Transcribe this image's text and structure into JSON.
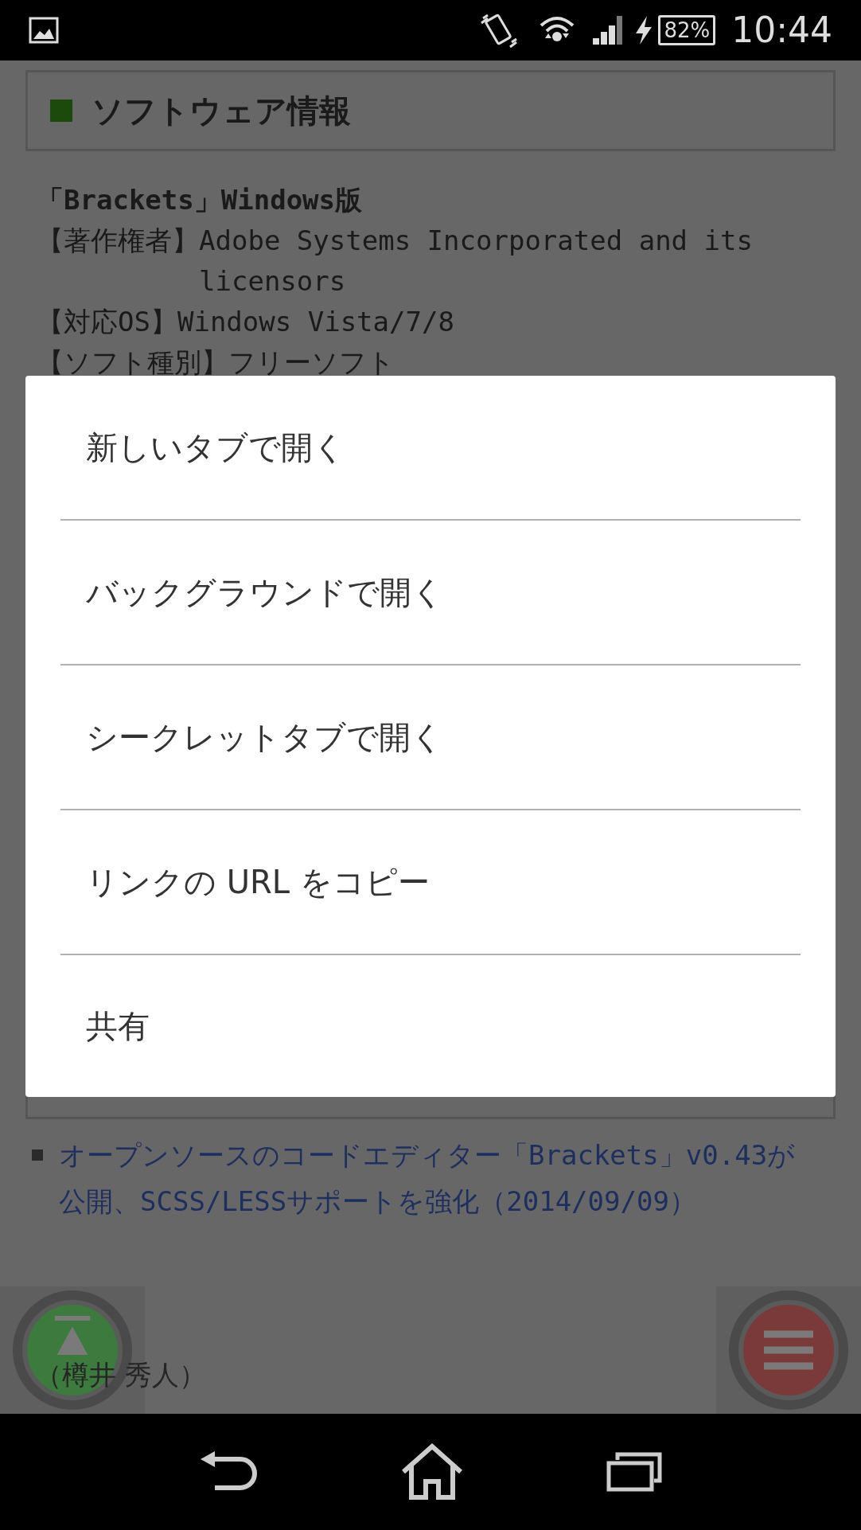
{
  "status_bar": {
    "battery": "82%",
    "time": "10:44"
  },
  "page": {
    "section_title": "ソフトウェア情報",
    "software_name": "「Brackets」Windows版",
    "info_lines": [
      {
        "label": "【著作権者】",
        "value": "Adobe Systems Incorporated and its licensors"
      },
      {
        "label": "【対応OS】",
        "value": "Windows Vista/7/8"
      },
      {
        "label": "【ソフト種別】",
        "value": "フリーソフト"
      }
    ],
    "related_links": [
      {
        "text": "オープンソースのコードエディター「Brackets」v0.43が公開、SCSS/LESSサポートを強化（2014/09/09）"
      }
    ],
    "author": "（樽井 秀人）"
  },
  "context_menu": {
    "items": [
      {
        "label": "新しいタブで開く"
      },
      {
        "label": "バックグラウンドで開く"
      },
      {
        "label": "シークレットタブで開く"
      },
      {
        "label": "リンクの URL をコピー"
      },
      {
        "label": "共有"
      }
    ]
  }
}
